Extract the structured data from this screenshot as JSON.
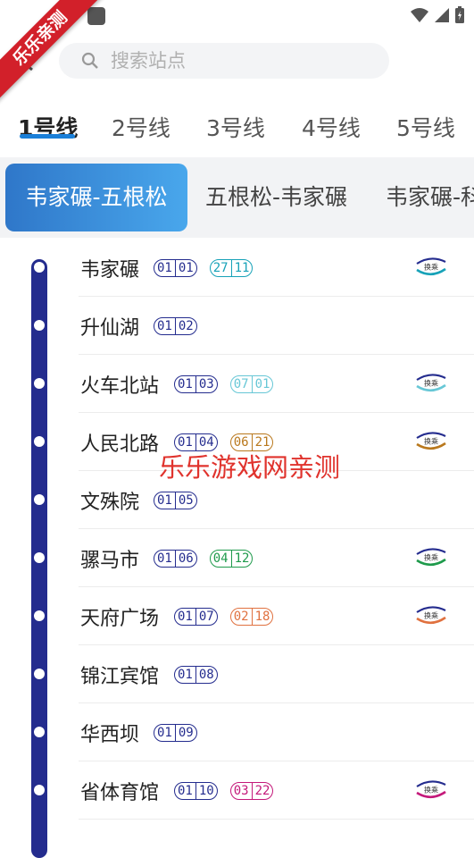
{
  "app": {
    "ribbon": "乐乐亲测",
    "watermark": "乐乐游戏网亲测"
  },
  "search": {
    "placeholder": "搜索站点",
    "value": ""
  },
  "line_tabs": [
    {
      "label": "1号线",
      "active": true
    },
    {
      "label": "2号线",
      "active": false
    },
    {
      "label": "3号线",
      "active": false
    },
    {
      "label": "4号线",
      "active": false
    },
    {
      "label": "5号线",
      "active": false
    }
  ],
  "directions": [
    {
      "label": "韦家碾-五根松",
      "active": true
    },
    {
      "label": "五根松-韦家碾",
      "active": false
    },
    {
      "label": "韦家碾-科",
      "active": false
    }
  ],
  "colors": {
    "line1": "#242c8e",
    "accent": "#1a7fd8",
    "line27": "#17a2b8",
    "line7": "#67c7d6",
    "line6": "#b9781d",
    "line4": "#1e9a4b",
    "line2": "#e0713f",
    "line3": "#c4197a"
  },
  "transfer_label": "换乘",
  "stations": [
    {
      "name": "韦家碾",
      "codes": [
        {
          "line": "01",
          "num": "01",
          "color": "#242c8e"
        },
        {
          "line": "27",
          "num": "11",
          "color": "#17a2b8"
        }
      ],
      "transfer": true,
      "transfer_color": "#17a2b8"
    },
    {
      "name": "升仙湖",
      "codes": [
        {
          "line": "01",
          "num": "02",
          "color": "#242c8e"
        }
      ],
      "transfer": false
    },
    {
      "name": "火车北站",
      "codes": [
        {
          "line": "01",
          "num": "03",
          "color": "#242c8e"
        },
        {
          "line": "07",
          "num": "01",
          "color": "#67c7d6"
        }
      ],
      "transfer": true,
      "transfer_color": "#67c7d6"
    },
    {
      "name": "人民北路",
      "codes": [
        {
          "line": "01",
          "num": "04",
          "color": "#242c8e"
        },
        {
          "line": "06",
          "num": "21",
          "color": "#b9781d"
        }
      ],
      "transfer": true,
      "transfer_color": "#b9781d"
    },
    {
      "name": "文殊院",
      "codes": [
        {
          "line": "01",
          "num": "05",
          "color": "#242c8e"
        }
      ],
      "transfer": false
    },
    {
      "name": "骡马市",
      "codes": [
        {
          "line": "01",
          "num": "06",
          "color": "#242c8e"
        },
        {
          "line": "04",
          "num": "12",
          "color": "#1e9a4b"
        }
      ],
      "transfer": true,
      "transfer_color": "#1e9a4b"
    },
    {
      "name": "天府广场",
      "codes": [
        {
          "line": "01",
          "num": "07",
          "color": "#242c8e"
        },
        {
          "line": "02",
          "num": "18",
          "color": "#e0713f"
        }
      ],
      "transfer": true,
      "transfer_color": "#e0713f"
    },
    {
      "name": "锦江宾馆",
      "codes": [
        {
          "line": "01",
          "num": "08",
          "color": "#242c8e"
        }
      ],
      "transfer": false
    },
    {
      "name": "华西坝",
      "codes": [
        {
          "line": "01",
          "num": "09",
          "color": "#242c8e"
        }
      ],
      "transfer": false
    },
    {
      "name": "省体育馆",
      "codes": [
        {
          "line": "01",
          "num": "10",
          "color": "#242c8e"
        },
        {
          "line": "03",
          "num": "22",
          "color": "#c4197a"
        }
      ],
      "transfer": true,
      "transfer_color": "#c4197a"
    }
  ]
}
